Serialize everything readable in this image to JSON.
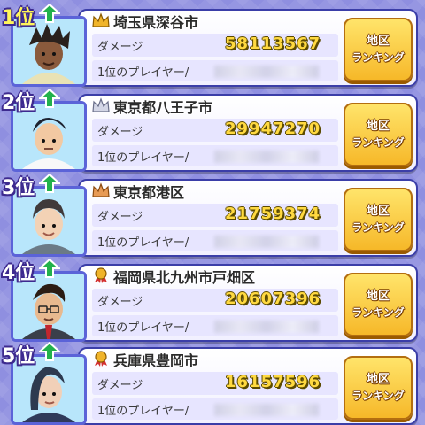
{
  "labels": {
    "damage": "ダメージ",
    "top_player": "1位のプレイヤー/",
    "button_line1": "地区",
    "button_line2": "ランキング"
  },
  "rows": [
    {
      "rank": "1位",
      "region": "埼玉県深谷市",
      "damage": "58113567",
      "badge": "gold-crown-icon",
      "avatar_hair": "#2a211d",
      "avatar_skin": "#8a5a3c"
    },
    {
      "rank": "2位",
      "region": "東京都八王子市",
      "damage": "29947270",
      "badge": "silver-crown-icon",
      "avatar_hair": "#1e2330",
      "avatar_skin": "#f2c9a2"
    },
    {
      "rank": "3位",
      "region": "東京都港区",
      "damage": "21759374",
      "badge": "bronze-crown-icon",
      "avatar_hair": "#403a3a",
      "avatar_skin": "#f3d2b5"
    },
    {
      "rank": "4位",
      "region": "福岡県北九州市戸畑区",
      "damage": "20607396",
      "badge": "ribbon-medal-icon",
      "avatar_hair": "#2b1c14",
      "avatar_skin": "#e8b98f"
    },
    {
      "rank": "5位",
      "region": "兵庫県豊岡市",
      "damage": "16157596",
      "badge": "ribbon-medal-icon",
      "avatar_hair": "#2d3a4f",
      "avatar_skin": "#f1d0b8"
    }
  ],
  "colors": {
    "background": "#8f8fe0",
    "card_border": "#3b3ea8",
    "damage_text": "#ffd940",
    "button_fill": "#f6b829",
    "up_arrow": "#22b14c"
  }
}
